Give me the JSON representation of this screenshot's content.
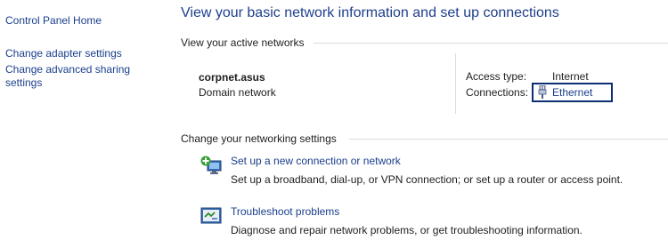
{
  "nav": {
    "home": "Control Panel Home",
    "adapter": "Change adapter settings",
    "advanced_sharing": "Change advanced sharing settings"
  },
  "main": {
    "title": "View your basic network information and set up connections",
    "active_networks_label": "View your active networks",
    "network": {
      "name": "corpnet.asus",
      "type": "Domain network",
      "access_type_label": "Access type:",
      "access_type_value": "Internet",
      "connections_label": "Connections:",
      "connection_link": "Ethernet",
      "connection_icon": "ethernet-plug-icon"
    },
    "change_settings_label": "Change your networking settings",
    "tasks": [
      {
        "icon": "new-connection-icon",
        "link": "Set up a new connection or network",
        "description": "Set up a broadband, dial-up, or VPN connection; or set up a router or access point."
      },
      {
        "icon": "troubleshoot-icon",
        "link": "Troubleshoot problems",
        "description": "Diagnose and repair network problems, or get troubleshooting information."
      }
    ]
  },
  "colors": {
    "link": "#1a3f8c",
    "title": "#1e3f8c",
    "focus_box": "#0c2e73",
    "divider": "#dcdcdc"
  }
}
